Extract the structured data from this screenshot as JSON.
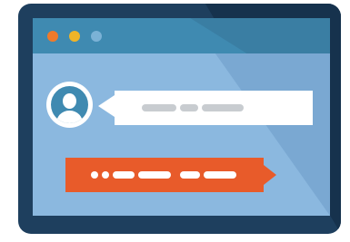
{
  "colors": {
    "frame": "#1e3f5e",
    "window": "#8bb8df",
    "titlebar": "#3f8ab1",
    "accent_orange": "#e85b2a",
    "placeholder_gray": "#c8ccd0"
  },
  "titlebar": {
    "controls": [
      {
        "name": "close",
        "color": "#f07a2a"
      },
      {
        "name": "minimize",
        "color": "#f0b428"
      },
      {
        "name": "maximize",
        "color": "#7bb2d6"
      }
    ]
  },
  "icons": {
    "avatar": "user-avatar-icon"
  }
}
